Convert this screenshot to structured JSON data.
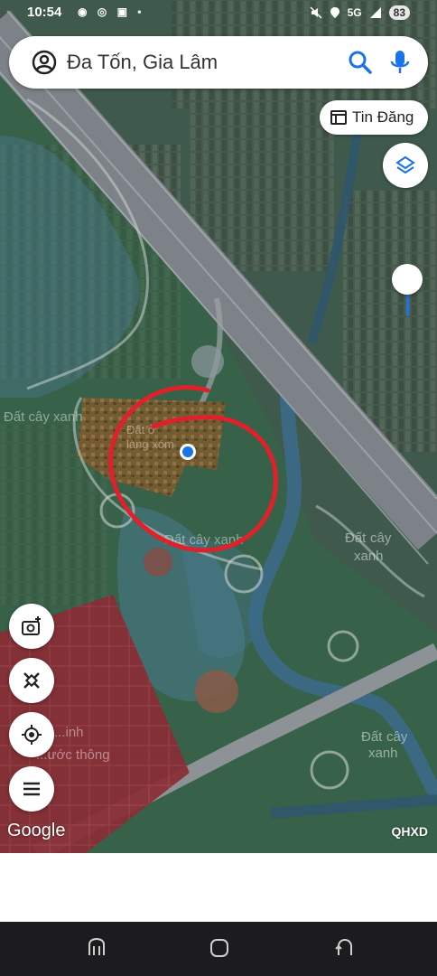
{
  "status_bar": {
    "time": "10:54",
    "app_icons": "◉ ◎ ▣ •",
    "signal": "5G",
    "battery": "83"
  },
  "search": {
    "query": "Đa Tốn, Gia Lâm"
  },
  "toolbar": {
    "news_label": "Tin Đăng"
  },
  "map": {
    "attribution": "Google",
    "layer_code": "QHXD",
    "labels": {
      "green_land_1": "Đất cây xanh",
      "green_land_2": "Đất cây xanh",
      "green_land_3": "Đất cây xanh",
      "green_land_4": "Đất cây xanh",
      "ne_label_1": "Đất",
      "ne_label_2": "cây",
      "ne_label_3": "xanh",
      "se_label_1": "Đất",
      "se_label_2": "cây",
      "se_label_3": "xanh",
      "red_zone_1": "...inh",
      "red_zone_2": "...ước thông",
      "center_label_1": "Đất ở",
      "center_label_2": "làng xóm"
    }
  },
  "colors": {
    "accent": "#1a73e8",
    "annotation_circle": "#e0212b",
    "planning_red_zone": "#8e2a33"
  }
}
